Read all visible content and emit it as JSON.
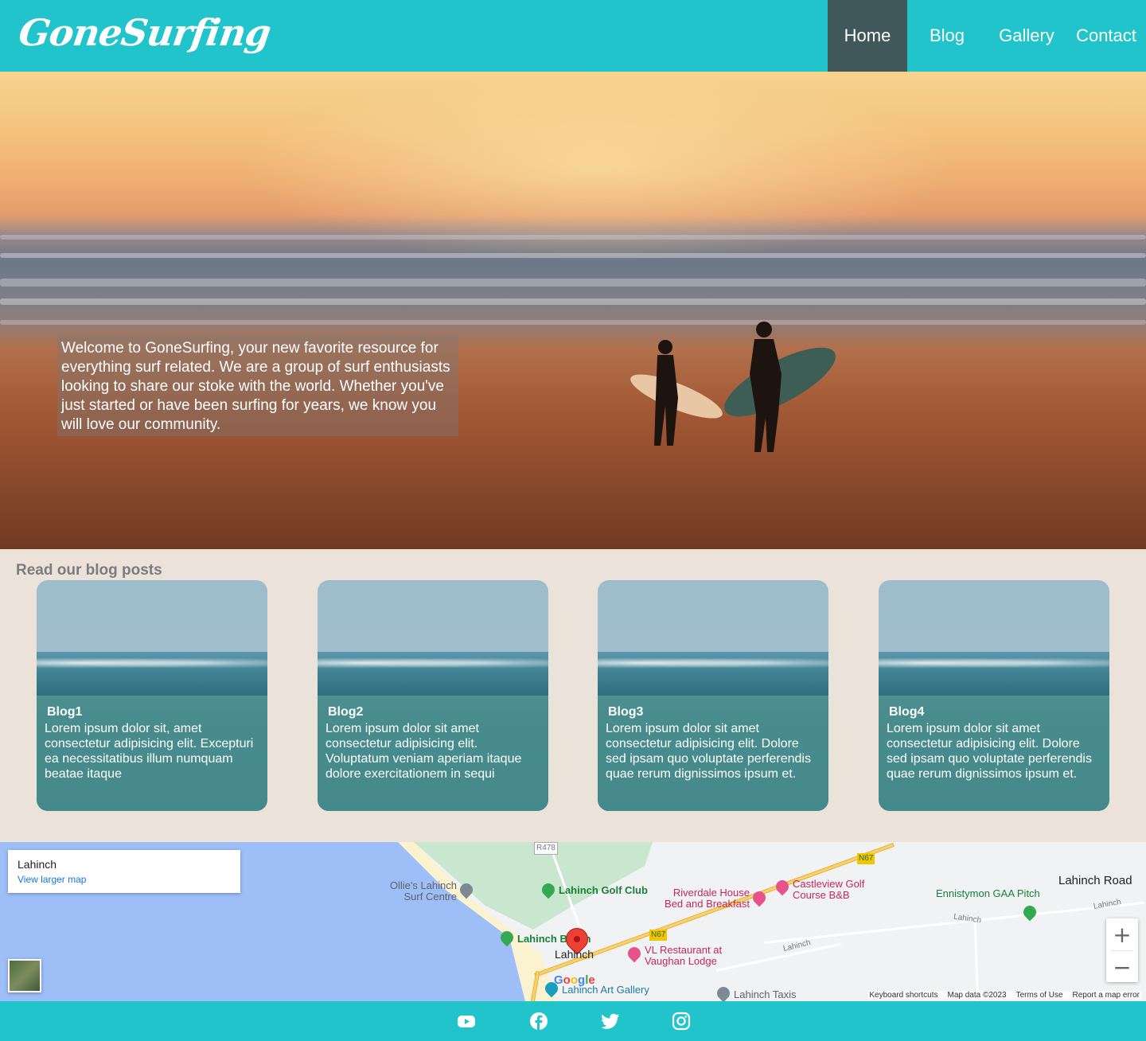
{
  "header": {
    "logo": "GoneSurfing",
    "nav": [
      "Home",
      "Blog",
      "Gallery",
      "Contact"
    ],
    "active": "Home"
  },
  "hero": {
    "text": "Welcome to GoneSurfing, your new favorite resource for everything surf related. We are a group of surf enthusiasts looking to share our stoke with the world. Whether you've just started or have been surfing for years, we know you will love our community."
  },
  "blog": {
    "heading": "Read our blog posts",
    "cards": [
      {
        "title": "Blog1",
        "body": "Lorem ipsum dolor sit, amet consectetur adipisicing elit. Excepturi ea necessitatibus illum numquam beatae itaque"
      },
      {
        "title": "Blog2",
        "body": "Lorem ipsum dolor sit amet consectetur adipisicing elit. Voluptatum veniam aperiam itaque dolore exercitationem in sequi"
      },
      {
        "title": "Blog3",
        "body": "Lorem ipsum dolor sit amet consectetur adipisicing elit. Dolore sed ipsam quo voluptate perferendis quae rerum dignissimos ipsum et."
      },
      {
        "title": "Blog4",
        "body": "Lorem ipsum dolor sit amet consectetur adipisicing elit. Dolore sed ipsam quo voluptate perferendis quae rerum dignissimos ipsum et."
      }
    ]
  },
  "map": {
    "place_title": "Lahinch",
    "view_larger": "View larger map",
    "labels": {
      "ollies": "Ollie's Lahinch Surf Centre",
      "golf_club": "Lahinch Golf Club",
      "riverdale": "Riverdale House Bed and Breakfast",
      "castleview": "Castleview Golf Course B&B",
      "gaa": "Ennistymon GAA Pitch",
      "lahinch_road": "Lahinch Road",
      "lahinch_beach": "Lahinch Beach",
      "lahinch": "Lahinch",
      "vl_restaurant": "VL Restaurant at Vaughan Lodge",
      "art_gallery": "Lahinch Art Gallery",
      "taxis": "Lahinch Taxis",
      "r478": "R478",
      "n67a": "N67",
      "n67b": "N67",
      "road_small_1": "Lahinch",
      "road_small_2": "Lahinch",
      "road_small_3": "Lahinch"
    },
    "google": "Google",
    "zoom_in": "+",
    "zoom_out": "−",
    "footer": [
      "Keyboard shortcuts",
      "Map data ©2023",
      "Terms of Use",
      "Report a map error"
    ]
  },
  "footer": {
    "icons": [
      "youtube-icon",
      "facebook-icon",
      "twitter-icon",
      "instagram-icon"
    ]
  },
  "colors": {
    "brand": "#22c4cc",
    "nav_active": "#40585a",
    "card_overlay": "#468c8a",
    "page_bg": "#ebe2d9"
  }
}
